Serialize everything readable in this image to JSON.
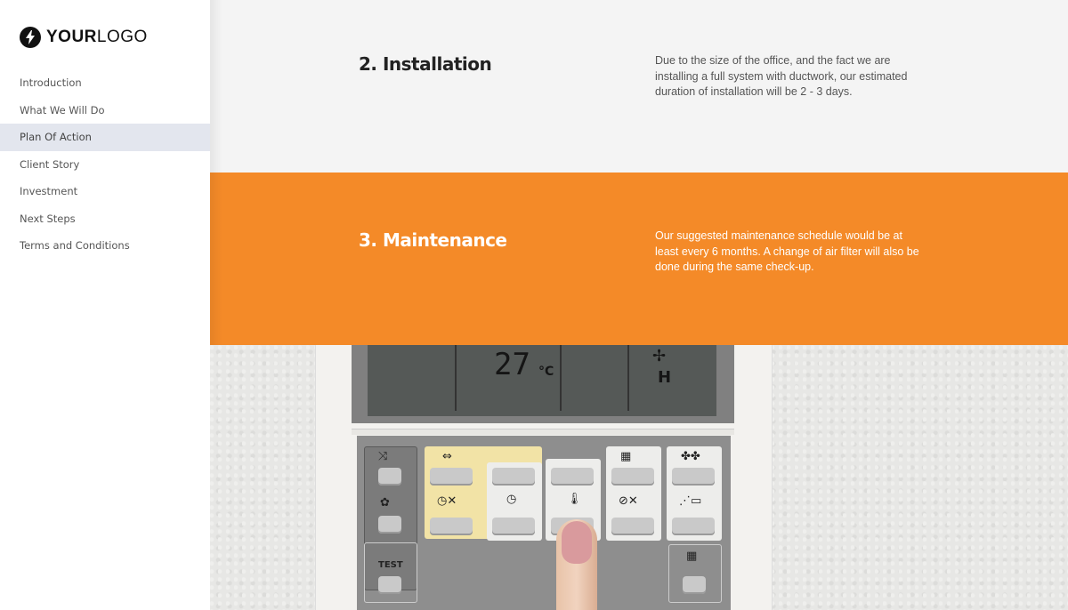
{
  "logo": {
    "bold": "YOUR",
    "light": "LOGO",
    "icon": "lightning-bolt-icon"
  },
  "sidebar": {
    "items": [
      {
        "label": "Introduction",
        "active": false
      },
      {
        "label": "What We Will Do",
        "active": false
      },
      {
        "label": "Plan Of Action",
        "active": true
      },
      {
        "label": "Client Story",
        "active": false
      },
      {
        "label": "Investment",
        "active": false
      },
      {
        "label": "Next Steps",
        "active": false
      },
      {
        "label": "Terms and Conditions",
        "active": false
      }
    ]
  },
  "sections": [
    {
      "title": "2. Installation",
      "body": "Due to the size of the office, and the fact we are installing a full system with ductwork, our estimated duration of installation will be 2 - 3 days."
    },
    {
      "title": "3. Maintenance",
      "body": "Our suggested maintenance schedule would be at least every 6 months. A change of air filter will also be done during the same check-up."
    }
  ],
  "colors": {
    "accent": "#f48a28",
    "section_bg": "#f4f4f4",
    "active_nav": "#e3e6ee"
  },
  "photo": {
    "description": "Finger pressing button on air conditioning wall remote control",
    "lcd_temp": "27",
    "lcd_unit": "°C",
    "lcd_fan_mode": "H",
    "test_label": "TEST"
  }
}
